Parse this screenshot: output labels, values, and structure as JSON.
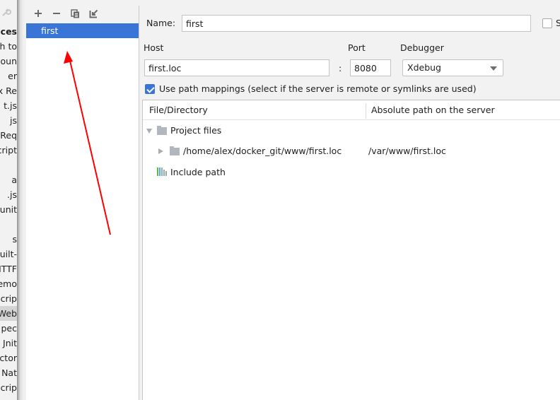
{
  "settings_tree": {
    "items": [
      {
        "label": "ces",
        "bold": true
      },
      {
        "label": "h to"
      },
      {
        "label": "poun"
      },
      {
        "label": "er"
      },
      {
        "label": "ox Re"
      },
      {
        "label": "t.js"
      },
      {
        "label": "js"
      },
      {
        "label": "Req"
      },
      {
        "label": "cript"
      },
      {
        "label": ""
      },
      {
        "label": "a"
      },
      {
        "label": ".js"
      },
      {
        "label": "unit"
      },
      {
        "label": ""
      },
      {
        "label": "s"
      },
      {
        "label": "Built-"
      },
      {
        "label": "HTTF"
      },
      {
        "label": "Remo"
      },
      {
        "label": "Scrip"
      },
      {
        "label": "Web",
        "selected": true
      },
      {
        "label": "pec"
      },
      {
        "label": "Jnit"
      },
      {
        "label": "actor"
      },
      {
        "label": "t Nat"
      },
      {
        "label": "Scrip"
      }
    ]
  },
  "server_list": {
    "toolbar": {
      "add": "add-icon",
      "remove": "remove-icon",
      "copy": "copy-icon",
      "import": "import-icon"
    },
    "items": [
      {
        "label": "first",
        "selected": true
      }
    ]
  },
  "form": {
    "name_label": "Name:",
    "name_value": "first",
    "shared_label": "S",
    "shared_checked": false,
    "host_label": "Host",
    "host_value": "first.loc",
    "colon": ":",
    "port_label": "Port",
    "port_value": "8080",
    "debugger_label": "Debugger",
    "debugger_value": "Xdebug",
    "use_path_mappings_label": "Use path mappings (select if the server is remote or symlinks are used)",
    "use_path_mappings_checked": true
  },
  "mappings_table": {
    "columns": [
      "File/Directory",
      "Absolute path on the server"
    ],
    "rows": [
      {
        "label": "Project files",
        "server_path": "",
        "expanded": true,
        "level": 0,
        "icon": "folder-icon"
      },
      {
        "label": "/home/alex/docker_git/www/first.loc",
        "server_path": "/var/www/first.loc",
        "expanded": false,
        "level": 1,
        "icon": "folder-icon"
      },
      {
        "label": "Include path",
        "server_path": "",
        "level": 0,
        "icon": "library-icon"
      }
    ]
  },
  "colors": {
    "selection": "#3875d7",
    "annotation_arrow": "#ff0000"
  }
}
